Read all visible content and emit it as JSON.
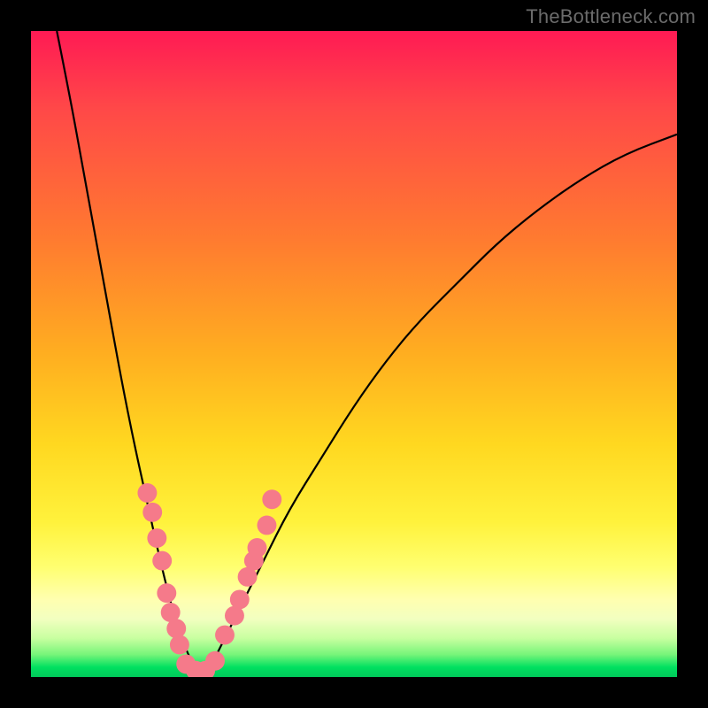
{
  "watermark": "TheBottleneck.com",
  "chart_data": {
    "type": "line",
    "title": "",
    "xlabel": "",
    "ylabel": "",
    "xlim": [
      0,
      100
    ],
    "ylim": [
      0,
      100
    ],
    "series": [
      {
        "name": "bottleneck-curve",
        "x": [
          4,
          6,
          8,
          10,
          12,
          14,
          16,
          18,
          20,
          22,
          23.5,
          25,
          26.5,
          28,
          30,
          33,
          36,
          40,
          45,
          50,
          55,
          60,
          66,
          72,
          78,
          85,
          92,
          100
        ],
        "values": [
          100,
          90,
          79,
          68,
          57,
          46,
          36,
          27,
          18,
          10,
          5.5,
          2,
          0.5,
          2,
          6,
          12,
          18,
          26,
          34,
          42,
          49,
          55,
          61,
          67,
          72,
          77,
          81,
          84
        ]
      }
    ],
    "markers": {
      "name": "highlighted-points",
      "color": "#f57a8a",
      "radius_pct": 1.5,
      "points": [
        {
          "x": 18.0,
          "y": 28.5
        },
        {
          "x": 18.8,
          "y": 25.5
        },
        {
          "x": 19.5,
          "y": 21.5
        },
        {
          "x": 20.3,
          "y": 18.0
        },
        {
          "x": 21.0,
          "y": 13.0
        },
        {
          "x": 21.6,
          "y": 10.0
        },
        {
          "x": 22.5,
          "y": 7.5
        },
        {
          "x": 23.0,
          "y": 5.0
        },
        {
          "x": 24.0,
          "y": 2.0
        },
        {
          "x": 25.5,
          "y": 1.0
        },
        {
          "x": 27.0,
          "y": 1.0
        },
        {
          "x": 28.5,
          "y": 2.5
        },
        {
          "x": 30.0,
          "y": 6.5
        },
        {
          "x": 31.5,
          "y": 9.5
        },
        {
          "x": 32.3,
          "y": 12.0
        },
        {
          "x": 33.5,
          "y": 15.5
        },
        {
          "x": 34.5,
          "y": 18.0
        },
        {
          "x": 35.0,
          "y": 20.0
        },
        {
          "x": 36.5,
          "y": 23.5
        },
        {
          "x": 37.3,
          "y": 27.5
        }
      ]
    },
    "grid": false,
    "legend": false
  }
}
